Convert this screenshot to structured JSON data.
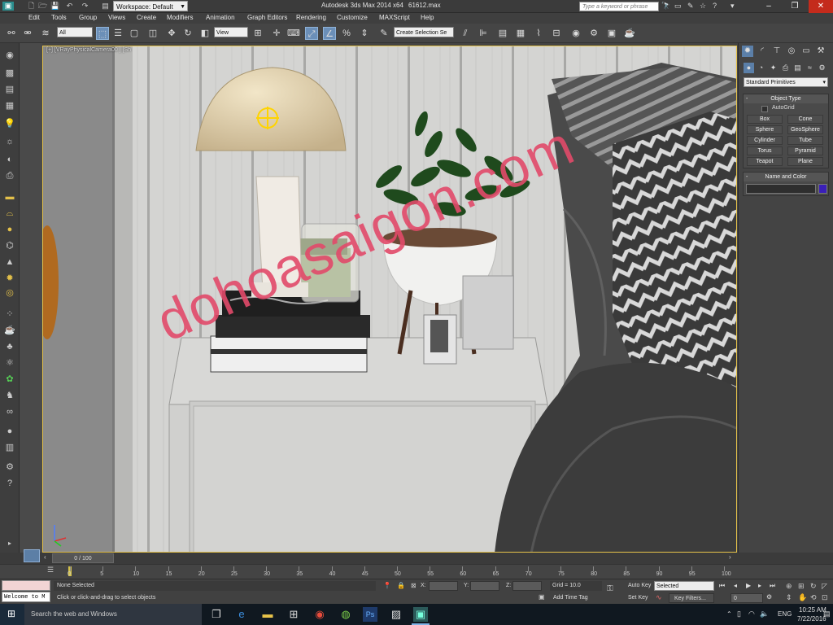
{
  "title_bar": {
    "workspace": "Workspace: Default",
    "app_title": "Autodesk 3ds Max  2014 x64",
    "file_name": "61612.max",
    "search_placeholder": "Type a keyword or phrase"
  },
  "menu": [
    "Edit",
    "Tools",
    "Group",
    "Views",
    "Create",
    "Modifiers",
    "Animation",
    "Graph Editors",
    "Rendering",
    "Customize",
    "MAXScript",
    "Help"
  ],
  "toolbar": {
    "filter_selected": "All",
    "ref_coord": "View",
    "selection_set": "Create Selection Se"
  },
  "viewport": {
    "label": "[+] [VRayPhysicalCamera00 ] [Sh",
    "watermark": "dohoasaigon.com"
  },
  "command_panel": {
    "category": "Standard Primitives",
    "object_type_title": "Object Type",
    "autogrid_label": "AutoGrid",
    "primitives": [
      "Box",
      "Cone",
      "Sphere",
      "GeoSphere",
      "Cylinder",
      "Tube",
      "Torus",
      "Pyramid",
      "Teapot",
      "Plane"
    ],
    "name_color_title": "Name and Color",
    "object_color": "#3a1fb8"
  },
  "time": {
    "frame_counter": "0 / 100",
    "ruler_ticks": [
      "0",
      "5",
      "10",
      "15",
      "20",
      "25",
      "30",
      "35",
      "40",
      "45",
      "50",
      "55",
      "60",
      "65",
      "70",
      "75",
      "80",
      "85",
      "90",
      "95",
      "100"
    ]
  },
  "status": {
    "maxscript_listener": "Welcome to M",
    "selection_status": "None Selected",
    "prompt": "Click or click-and-drag to select objects",
    "x_label": "X:",
    "y_label": "Y:",
    "z_label": "Z:",
    "grid": "Grid = 10.0",
    "add_time_tag": "Add Time Tag",
    "auto_key": "Auto Key",
    "set_key": "Set Key",
    "key_mode_selected": "Selected",
    "key_filters": "Key Filters...",
    "current_frame": "0"
  },
  "taskbar": {
    "search_placeholder": "Search the web and Windows",
    "language": "ENG",
    "time": "10:25 AM",
    "date": "7/22/2016"
  }
}
